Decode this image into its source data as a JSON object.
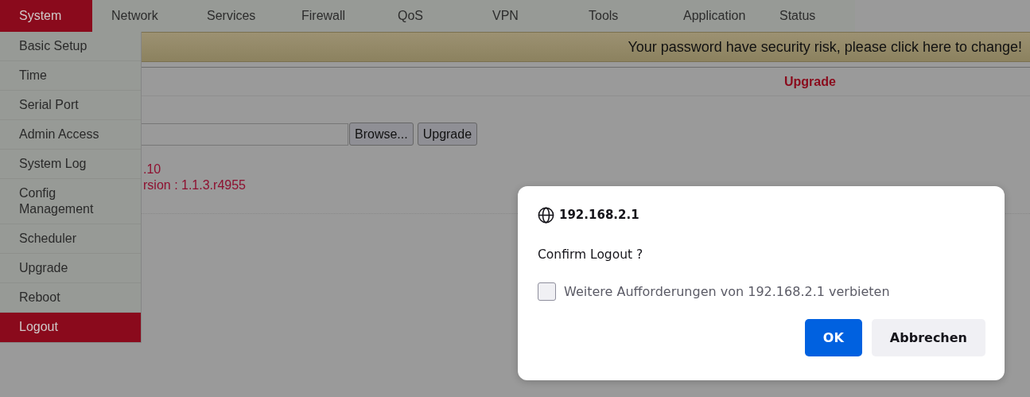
{
  "nav": [
    {
      "label": "System",
      "selected": true
    },
    {
      "label": "Network",
      "selected": false
    },
    {
      "label": "Services",
      "selected": false
    },
    {
      "label": "Firewall",
      "selected": false
    },
    {
      "label": "QoS",
      "selected": false
    },
    {
      "label": "VPN",
      "selected": false
    },
    {
      "label": "Tools",
      "selected": false
    },
    {
      "label": "Application",
      "selected": false
    },
    {
      "label": "Status",
      "selected": false
    }
  ],
  "submenu": [
    {
      "label": "Basic Setup",
      "selected": false
    },
    {
      "label": "Time",
      "selected": false
    },
    {
      "label": "Serial Port",
      "selected": false
    },
    {
      "label": "Admin Access",
      "selected": false
    },
    {
      "label": "System Log",
      "selected": false
    },
    {
      "label": "Config Management",
      "selected": false
    },
    {
      "label": "Scheduler",
      "selected": false
    },
    {
      "label": "Upgrade",
      "selected": false
    },
    {
      "label": "Reboot",
      "selected": false
    },
    {
      "label": "Logout",
      "selected": true
    }
  ],
  "banner": "Your password have security risk, please click here to change!",
  "section_title": "Upgrade",
  "upload": {
    "buttons": [
      "Browse...",
      "Upgrade"
    ]
  },
  "info_lines": [
    ".10",
    "rsion : 1.1.3.r4955"
  ],
  "dialog": {
    "origin": "192.168.2.1",
    "message": "Confirm Logout ?",
    "checkbox": {
      "label": "Weitere Aufforderungen von 192.168.2.1 verbieten",
      "checked": false
    },
    "buttons": [
      {
        "label": "OK",
        "kind": "primary"
      },
      {
        "label": "Abbrechen",
        "kind": "secondary"
      }
    ]
  }
}
